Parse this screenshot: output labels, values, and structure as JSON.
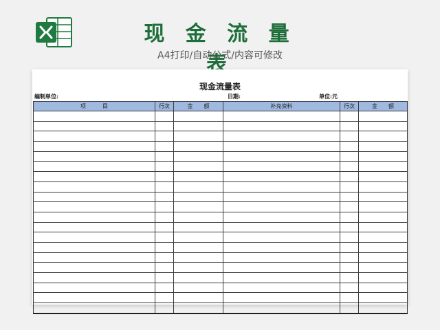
{
  "header": {
    "title": "现 金 流 量 表",
    "subtitle": "A4打印/自动公式/内容可修改",
    "logo_icon": "excel-logo-icon",
    "accent_color": "#1e6e3a"
  },
  "sheet": {
    "title": "现金流量表",
    "unit_prefix": "编制单位:",
    "date_label": "日期:",
    "currency_unit": "单位:元",
    "columns": [
      "项　　　目",
      "行次",
      "金　　额",
      "补充资料",
      "行次",
      "金　　额"
    ],
    "header_color": "#9fb9e0",
    "row_count": 20
  }
}
